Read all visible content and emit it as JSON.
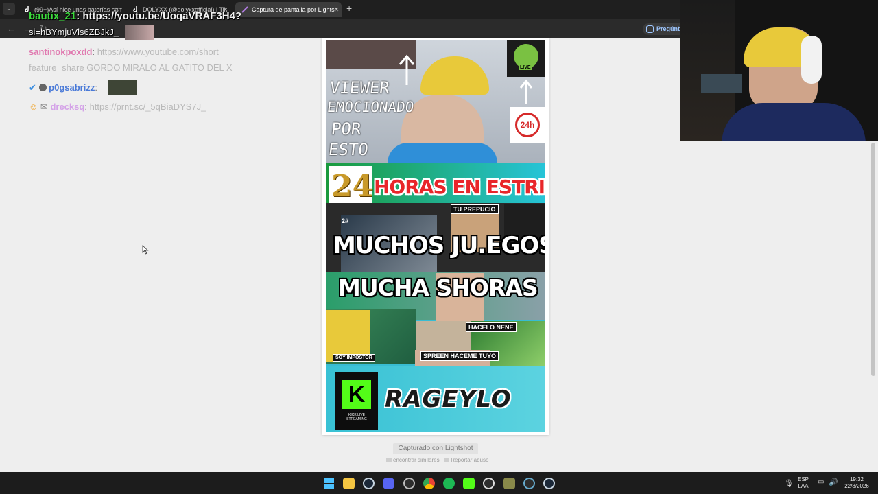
{
  "browser": {
    "tabs": [
      {
        "label": "(99+)Así hice unas baterías sam",
        "active": false
      },
      {
        "label": "DOLYXX (@dolyxxofficial) | Tik",
        "active": false
      },
      {
        "label": "Captura de pantalla por Lightsh",
        "active": true
      }
    ],
    "new_tab": "+",
    "tab_close": "×",
    "menu": "⌄",
    "back": "←",
    "forward": "→",
    "refresh": "↻",
    "ask_button": "Pregúnta"
  },
  "chat": {
    "messages": [
      {
        "user": "bautix_21",
        "text": "https://youtu.be/UoqaVRAF3H4?si=hBYmjuVls6ZBJkJ_",
        "user_color": "#f2f2f2"
      },
      {
        "user": "santinokpoxdd",
        "text": "https://www.youtube.com/shortfeature=share GORDO MIRALO AL GATITO DEL X",
        "user_color": "#e07ab0"
      },
      {
        "user": "p0gsabrizz",
        "text": "",
        "user_color": "#4a7ad8"
      },
      {
        "user": "drecksq",
        "text": "https://prnt.sc/_5qBiaDYS7J_",
        "user_color": "#d4a2e8"
      }
    ],
    "line1_user": "bautix_21",
    "line1_sep": ":",
    "line1_url_a": "https://youtu.be/UoqaVRAF3H4?",
    "line1_url_b": "si=hBYmjuVls6ZBJkJ_",
    "line2_user": "santinokpoxdd",
    "line2_sep": ":",
    "line2_text_a": "https://www.youtube.com/short",
    "line2_text_b": "feature=share GORDO MIRALO AL GATITO DEL X",
    "line3_user": "p0gsabrizz",
    "line3_sep": ":",
    "line4_user": "drecksq",
    "line4_sep": ":",
    "line4_text": "https://prnt.sc/_5qBiaDYS7J_"
  },
  "thumbnail": {
    "handwritten": [
      "VIEWER",
      "EMOCIONADO",
      "POR",
      "ESTO"
    ],
    "live_badge": "LIVE",
    "badge_24h": "24h",
    "number_24": "24",
    "headline_horas": "HORAS EN ESTRIM",
    "tag_prepucio": "TU PREPUCIO",
    "tag_hash": "2#",
    "muchos": "MUCHOS JU.EGOS",
    "mucha": "MUCHA SHORAS",
    "tag_impostor": "SOY IMPOSTOR",
    "tag_hacelo": "HACELO NENE",
    "tag_spreen": "SPREEN HACEME TUYO",
    "kick_k": "K",
    "kick_caption": "KICK LIVE STREAMING",
    "brand": "RAGEYLO"
  },
  "lightshot": {
    "captured_label": "Capturado con Lightshot",
    "find_similar": "encontrar similares",
    "report": "Reportar abuso"
  },
  "tray": {
    "lang_top": "ESP",
    "lang_bottom": "LAA",
    "time": "19:32",
    "date": "22/8/2026"
  },
  "colors": {
    "page_bg": "#eeeeee",
    "taskbar": "#1c1c1c",
    "link_blue": "#9ec7ff",
    "thumb_cyan": "#38bcd2",
    "horas_red": "#e8262a"
  }
}
